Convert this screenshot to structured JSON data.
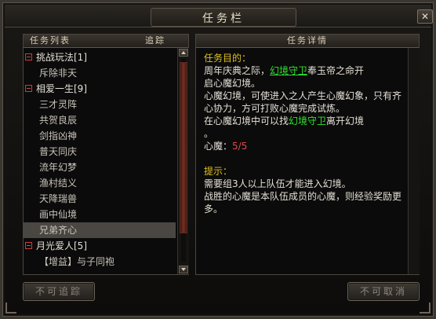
{
  "window": {
    "title": "任务栏",
    "close_glyph": "✕"
  },
  "left_panel": {
    "header_list": "任务列表",
    "header_track": "追踪",
    "rows": [
      {
        "type": "category",
        "label": "挑战玩法[1]"
      },
      {
        "type": "sub",
        "label": "斥除非天"
      },
      {
        "type": "category",
        "label": "相爱一生[9]"
      },
      {
        "type": "sub",
        "label": "三才灵阵"
      },
      {
        "type": "sub",
        "label": "共贺良辰"
      },
      {
        "type": "sub",
        "label": "剑指凶神"
      },
      {
        "type": "sub",
        "label": "普天同庆"
      },
      {
        "type": "sub",
        "label": "流年幻梦"
      },
      {
        "type": "sub",
        "label": "渔村结义"
      },
      {
        "type": "sub",
        "label": "天降瑞兽"
      },
      {
        "type": "sub",
        "label": "画中仙境"
      },
      {
        "type": "sub",
        "label": "兄弟齐心",
        "selected": true
      },
      {
        "type": "category",
        "label": "月光爱人[5]"
      },
      {
        "type": "sub",
        "label": "【增益】与子同袍"
      }
    ]
  },
  "right_panel": {
    "header": "任务详情",
    "goal_label": "任务目的：",
    "goal_line1_pre": "周年庆典之际，",
    "goal_link1": "幻境守卫",
    "goal_line1_post": "奉玉帝之命开",
    "goal_line2": "启心魔幻境。",
    "desc1": "心魔幻境，可使进入之人产生心魔幻象，只有齐心协力，方可打败心魔完成试炼。",
    "desc2_pre": "在心魔幻境中可以找",
    "desc2_link": "幻境守卫",
    "desc2_post": "离开幻境",
    "desc2_end": "。",
    "progress_label": "心魔：",
    "progress_value": "5/5",
    "tip_label": "提示：",
    "tip1": "需要组3人以上队伍才能进入幻境。",
    "tip2": "战胜的心魔是本队伍成员的心魔，则经验奖励更多。"
  },
  "buttons": {
    "track": "不可追踪",
    "cancel": "不可取消"
  },
  "colors": {
    "category_marker": "#d23a3a",
    "goal_label": "#e0c020",
    "link": "#2fe02f",
    "progress": "#e04a4a"
  },
  "icons": {
    "close": "close-icon",
    "expander": "collapse-minus-icon",
    "scroll_up": "arrow-up-icon",
    "scroll_down": "arrow-down-icon"
  }
}
